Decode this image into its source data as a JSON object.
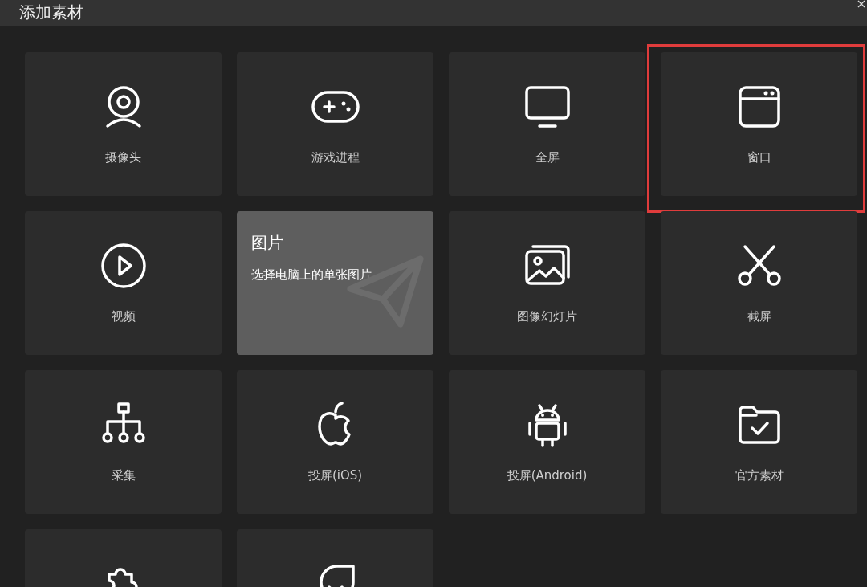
{
  "window": {
    "title": "添加素材"
  },
  "tiles": [
    {
      "label": "摄像头",
      "hovered": false,
      "highlighted": false
    },
    {
      "label": "游戏进程",
      "hovered": false,
      "highlighted": false
    },
    {
      "label": "全屏",
      "hovered": false,
      "highlighted": false
    },
    {
      "label": "窗口",
      "hovered": false,
      "highlighted": true
    },
    {
      "label": "视频",
      "hovered": false,
      "highlighted": false
    },
    {
      "label": "图片",
      "description": "选择电脑上的单张图片",
      "hovered": true,
      "highlighted": false
    },
    {
      "label": "图像幻灯片",
      "hovered": false,
      "highlighted": false
    },
    {
      "label": "截屏",
      "hovered": false,
      "highlighted": false
    },
    {
      "label": "采集",
      "hovered": false,
      "highlighted": false
    },
    {
      "label": "投屏(iOS)",
      "hovered": false,
      "highlighted": false
    },
    {
      "label": "投屏(Android)",
      "hovered": false,
      "highlighted": false
    },
    {
      "label": "官方素材",
      "hovered": false,
      "highlighted": false
    },
    {
      "hovered": false,
      "highlighted": false
    },
    {
      "hovered": false,
      "highlighted": false
    }
  ]
}
